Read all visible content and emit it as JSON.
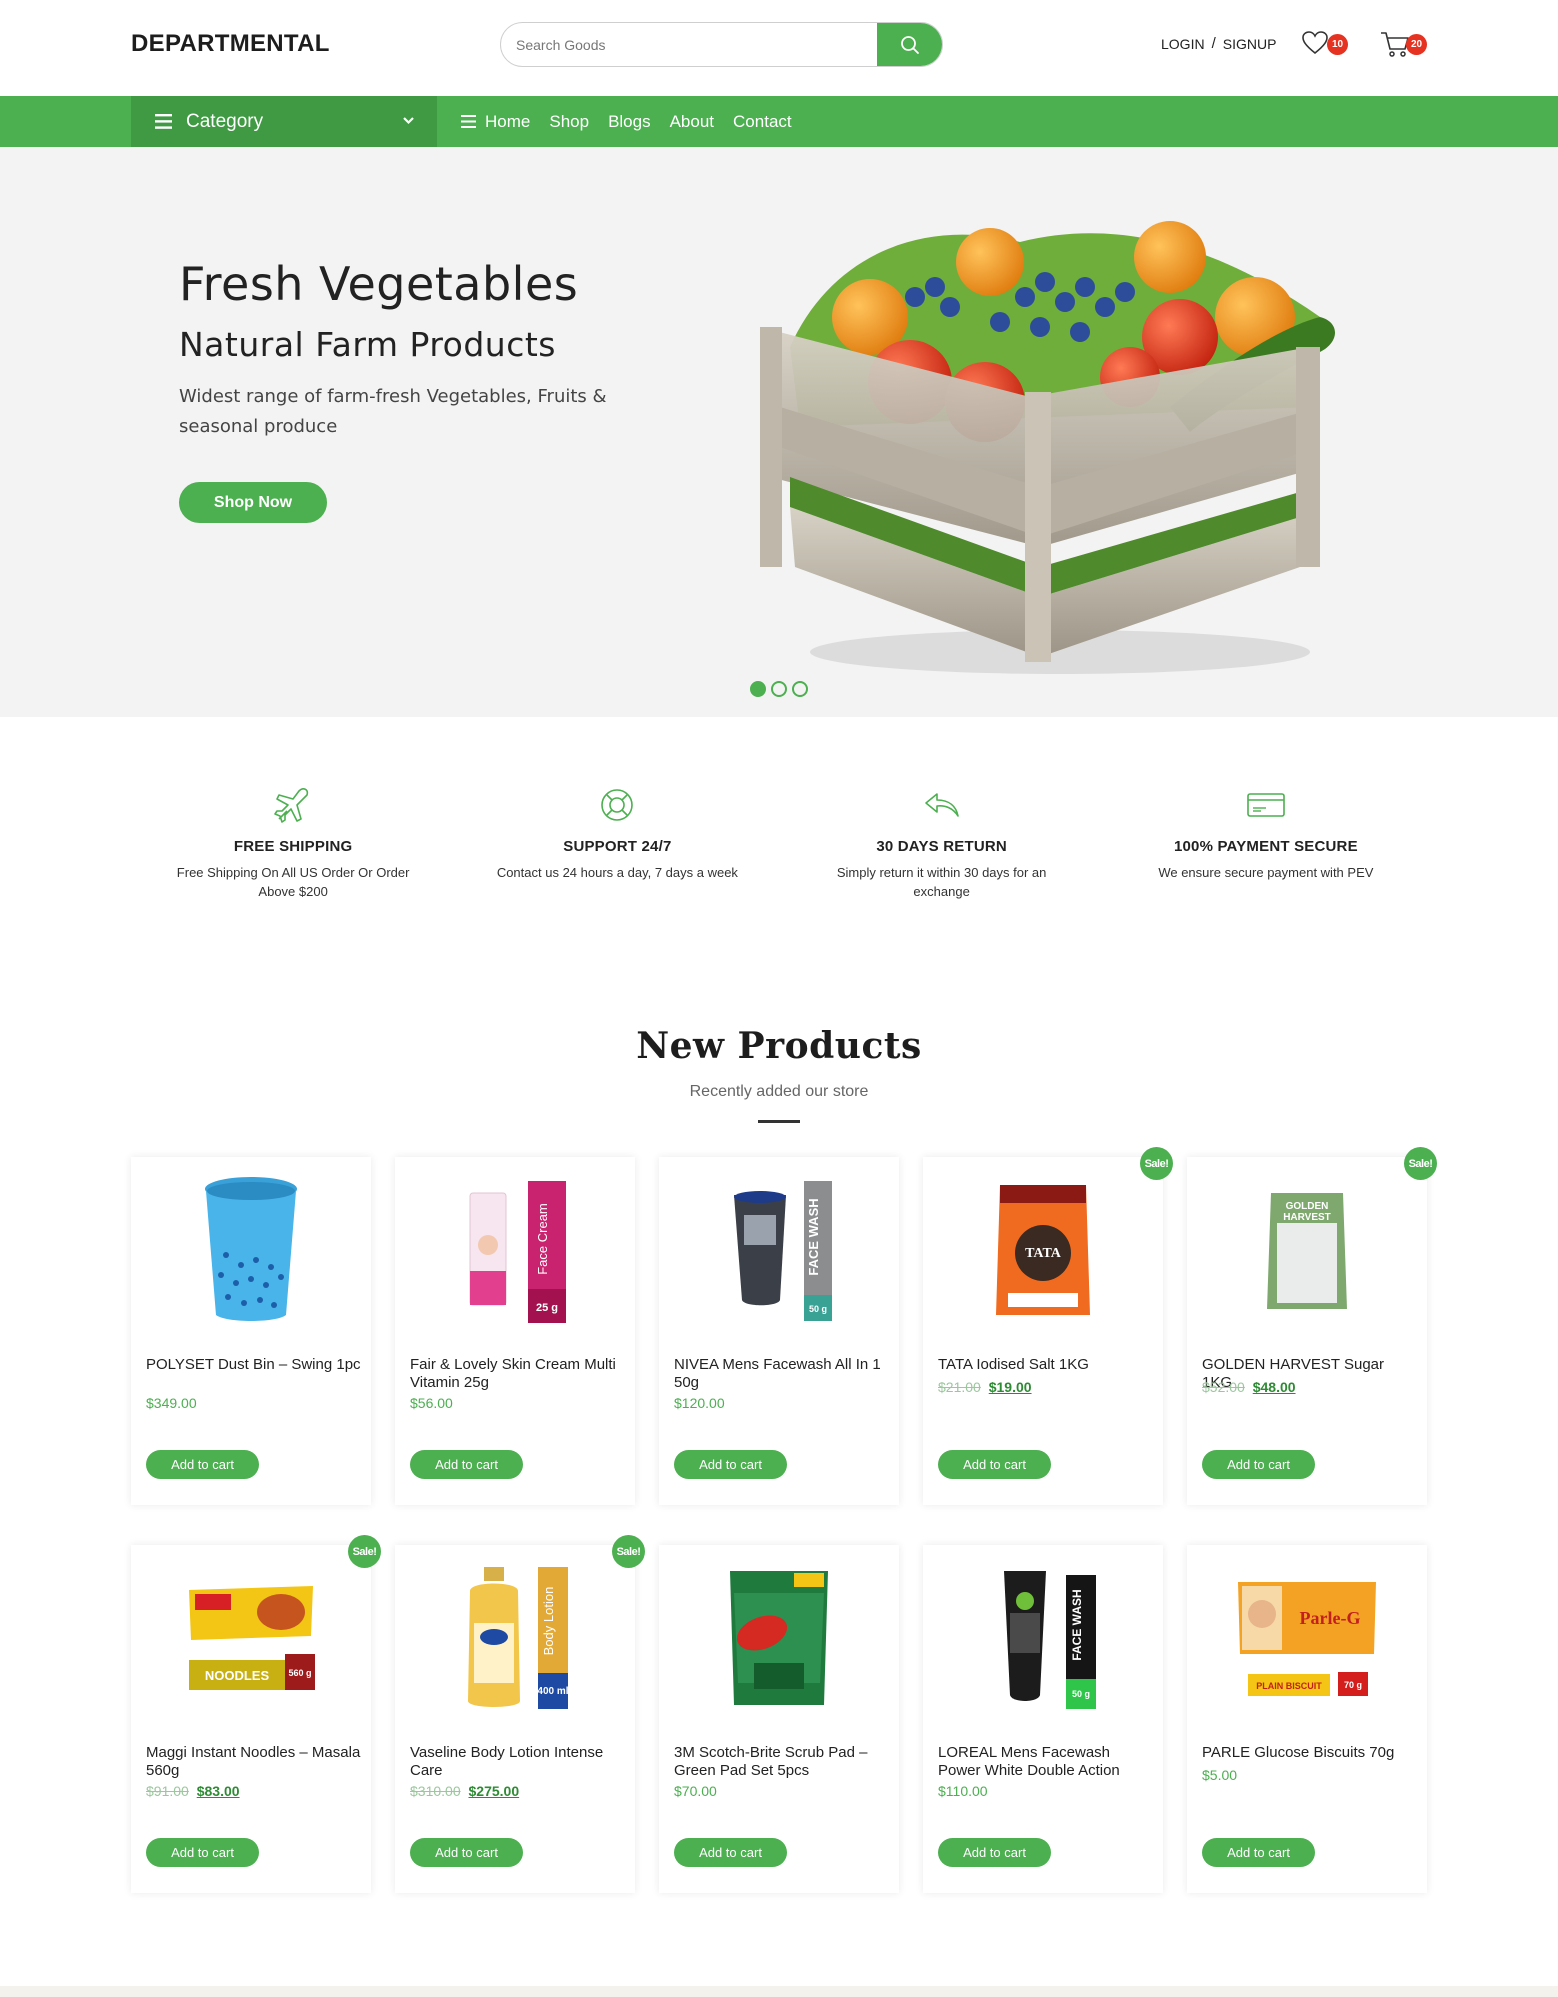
{
  "header": {
    "logo": "DEPARTMENTAL",
    "search": {
      "placeholder": "Search Goods"
    },
    "login": "LOGIN",
    "separator": "/",
    "signup": "SIGNUP",
    "wishlist_count": "10",
    "cart_count": "20"
  },
  "nav": {
    "category_label": "Category",
    "items": [
      "Home",
      "Shop",
      "Blogs",
      "About",
      "Contact"
    ]
  },
  "hero": {
    "title": "Fresh Vegetables",
    "subtitle": "Natural Farm Products",
    "description": "Widest range of farm-fresh Vegetables, Fruits & seasonal produce",
    "button": "Shop Now",
    "slides": 3,
    "active_slide": 1
  },
  "features": [
    {
      "icon": "airplane-icon",
      "title": "FREE SHIPPING",
      "text": "Free Shipping On All US Order Or Order Above $200"
    },
    {
      "icon": "lifebuoy-icon",
      "title": "SUPPORT 24/7",
      "text": "Contact us 24 hours a day, 7 days a week"
    },
    {
      "icon": "return-arrow-icon",
      "title": "30 DAYS RETURN",
      "text": "Simply return it within 30 days for an exchange"
    },
    {
      "icon": "credit-card-icon",
      "title": "100% PAYMENT SECURE",
      "text": "We ensure secure payment with PEV"
    }
  ],
  "section": {
    "title": "New Products",
    "subtitle": "Recently added our store"
  },
  "colors": {
    "accent": "#4caf50",
    "accent_dark": "#3f9a43",
    "badge": "#e53221"
  },
  "products": [
    {
      "name": "POLYSET Dust Bin – Swing 1pc",
      "price": "$349.00",
      "old_price": "",
      "sale": false,
      "image": "dustbin",
      "button": "Add to cart"
    },
    {
      "name": "Fair & Lovely Skin Cream Multi Vitamin 25g",
      "price": "$56.00",
      "old_price": "",
      "sale": false,
      "image": "face-cream",
      "tag": "Face Cream",
      "qty": "25 g",
      "button": "Add to cart"
    },
    {
      "name": "NIVEA Mens Facewash All In 1 50g",
      "price": "$120.00",
      "old_price": "",
      "sale": false,
      "image": "face-wash",
      "tag": "FACE WASH",
      "qty": "50 g",
      "button": "Add to cart"
    },
    {
      "name": "TATA Iodised Salt 1KG",
      "price": "$19.00",
      "old_price": "$21.00",
      "sale": true,
      "sale_label": "Sale!",
      "image": "salt",
      "button": "Add to cart"
    },
    {
      "name": "GOLDEN HARVEST Sugar 1KG",
      "price": "$48.00",
      "old_price": "$52.00",
      "sale": true,
      "sale_label": "Sale!",
      "image": "sugar",
      "button": "Add to cart"
    },
    {
      "name": "Maggi Instant Noodles – Masala 560g",
      "price": "$83.00",
      "old_price": "$91.00",
      "sale": true,
      "sale_label": "Sale!",
      "image": "noodles",
      "tag": "NOODLES",
      "qty": "560 g",
      "button": "Add to cart"
    },
    {
      "name": "Vaseline Body Lotion Intense Care",
      "price": "$275.00",
      "old_price": "$310.00",
      "sale": true,
      "sale_label": "Sale!",
      "image": "lotion",
      "tag": "Body Lotion",
      "qty": "400 ml",
      "button": "Add to cart"
    },
    {
      "name": "3M Scotch-Brite Scrub Pad – Green Pad Set 5pcs",
      "price": "$70.00",
      "old_price": "",
      "sale": false,
      "image": "scrub-pad",
      "button": "Add to cart"
    },
    {
      "name": "LOREAL Mens Facewash Power White Double Action",
      "price": "$110.00",
      "old_price": "",
      "sale": false,
      "image": "loreal-facewash",
      "tag": "FACE WASH",
      "qty": "50 g",
      "button": "Add to cart"
    },
    {
      "name": "PARLE Glucose Biscuits 70g",
      "price": "$5.00",
      "old_price": "",
      "sale": false,
      "image": "biscuits",
      "tag": "PLAIN BISCUIT",
      "qty": "70 g",
      "button": "Add to cart"
    }
  ]
}
